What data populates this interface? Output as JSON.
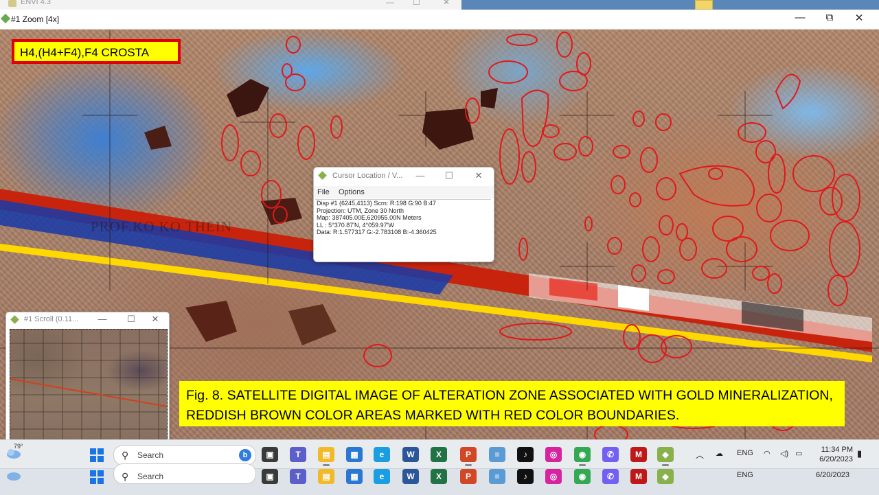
{
  "background_window": {
    "title": "ENVI 4.3",
    "controls": [
      "—",
      "☐",
      "✕"
    ]
  },
  "zoom_window": {
    "title": "#1 Zoom [4x]",
    "controls": [
      "—",
      "⧉",
      "✕"
    ]
  },
  "image": {
    "title_box": "H4,(H4+F4),F4 CROSTA",
    "faint_text": "PROF.KO KO THEIN",
    "caption": "Fig. 8. SATELLITE DIGITAL IMAGE OF ALTERATION ZONE ASSOCIATED WITH GOLD MINERALIZATION, REDDISH BROWN COLOR AREAS MARKED WITH RED COLOR BOUNDARIES.",
    "colors": {
      "boundary": "#e0181c",
      "caption_bg": "#ffff00",
      "title_border": "#e00000"
    }
  },
  "cursor_dialog": {
    "title": "Cursor Location / V...",
    "controls": [
      "—",
      "☐",
      "✕"
    ],
    "menu": [
      "File",
      "Options"
    ],
    "lines": [
      "Disp #1 (6245,4113) Scrn: R:198 G:90 B:47",
      "Projection: UTM, Zone 30 North",
      "Map: 387405.00E,620955.00N Meters",
      "LL : 5°370.87'N, 4°059.97'W",
      "Data: R:1.577317 G:-2.783108 B:-4.360425"
    ]
  },
  "scroll_window": {
    "title": "#1 Scroll (0.11...",
    "controls": [
      "—",
      "☐",
      "✕"
    ]
  },
  "taskbar": {
    "temperature": "79°",
    "search_placeholder": "Search",
    "bing_label": "b",
    "language": "ENG",
    "time": "11:34 PM",
    "date": "6/20/2023",
    "apps": [
      {
        "name": "task-view",
        "color": "#3a3a3a",
        "glyph": "▣"
      },
      {
        "name": "teams",
        "color": "#5b5fc7",
        "glyph": "T"
      },
      {
        "name": "file-explorer",
        "color": "#f2b928",
        "glyph": "▤"
      },
      {
        "name": "microsoft-store",
        "color": "#2b78d4",
        "glyph": "▦"
      },
      {
        "name": "edge",
        "color": "#1b9de2",
        "glyph": "e"
      },
      {
        "name": "word",
        "color": "#2b579a",
        "glyph": "W"
      },
      {
        "name": "excel",
        "color": "#217346",
        "glyph": "X"
      },
      {
        "name": "powerpoint",
        "color": "#d24726",
        "glyph": "P"
      },
      {
        "name": "notepad",
        "color": "#5a9bd5",
        "glyph": "≡"
      },
      {
        "name": "tiktok",
        "color": "#111111",
        "glyph": "♪"
      },
      {
        "name": "instagram",
        "color": "#d6249f",
        "glyph": "◎"
      },
      {
        "name": "chrome",
        "color": "#34a853",
        "glyph": "◉"
      },
      {
        "name": "viber",
        "color": "#7360f2",
        "glyph": "✆"
      },
      {
        "name": "mcafee",
        "color": "#c01818",
        "glyph": "M"
      },
      {
        "name": "envi",
        "color": "#88b04b",
        "glyph": "◆"
      }
    ]
  }
}
